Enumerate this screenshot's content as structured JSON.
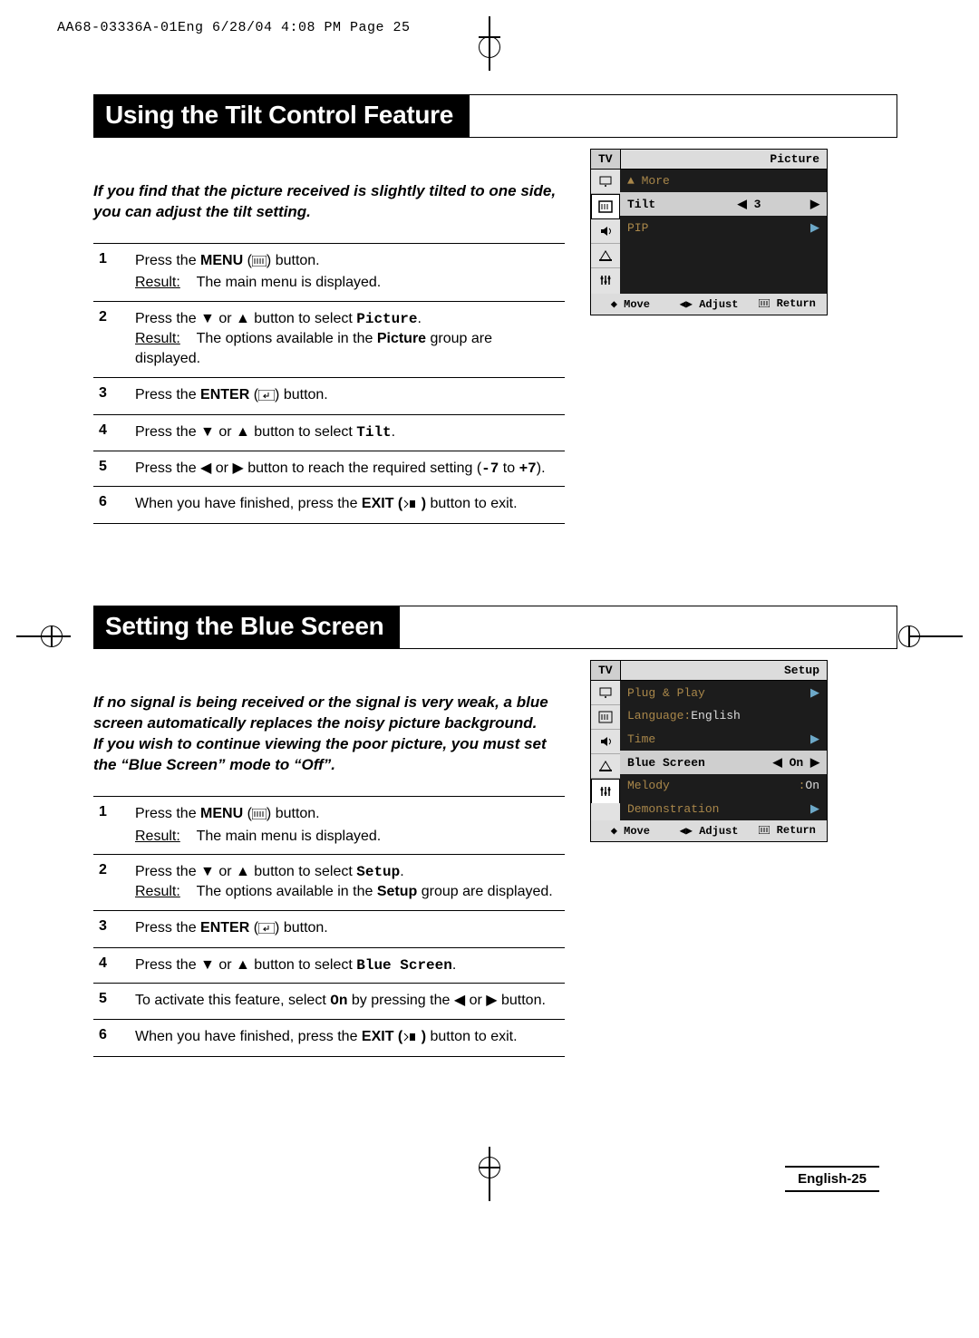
{
  "header_strip": "AA68-03336A-01Eng  6/28/04  4:08 PM  Page 25",
  "section1": {
    "title": "Using the Tilt Control Feature",
    "intro": "If you find that the picture received is slightly tilted to one side, you can adjust the tilt setting.",
    "steps": {
      "s1_a": "Press the ",
      "s1_b": "MENU",
      "s1_c": " button.",
      "s1_result_label": "Result:",
      "s1_result_text": "The main menu is displayed.",
      "s2_a": "Press the ▼ or ▲ button to select ",
      "s2_b": "Picture",
      "s2_c": ".",
      "s2_result_label": "Result:",
      "s2_result_text_a": "The options available in the ",
      "s2_result_text_b": "Picture",
      "s2_result_text_c": " group are displayed.",
      "s3_a": "Press the ",
      "s3_b": "ENTER",
      "s3_c": " button.",
      "s4_a": "Press the ▼ or ▲ button to select ",
      "s4_b": "Tilt",
      "s4_c": ".",
      "s5_a": "Press the ◀ or ▶ button to reach the required setting (",
      "s5_b": "-7",
      "s5_c": " to ",
      "s5_d": "+7",
      "s5_e": ").",
      "s6_a": "When you have finished, press the ",
      "s6_b": "EXIT (",
      "s6_c": " )",
      "s6_d": " button to exit."
    },
    "osd": {
      "title": "Picture",
      "more": "▲ More",
      "rows": [
        {
          "label": "Tilt",
          "lsym": "◀",
          "val": "3",
          "rsym": "▶",
          "sel": true
        },
        {
          "label": "PIP",
          "lsym": "",
          "val": "",
          "rsym": "▶",
          "sel": false
        }
      ],
      "foot_move": "Move",
      "foot_adjust": "Adjust",
      "foot_return": "Return"
    }
  },
  "section2": {
    "title": "Setting the Blue Screen",
    "intro": "If no signal is being received or the signal is very weak, a blue screen automatically replaces the noisy picture background.\nIf you wish to continue viewing the poor picture, you must set the “Blue Screen” mode to “Off”.",
    "steps": {
      "s1_a": "Press the ",
      "s1_b": "MENU",
      "s1_c": " button.",
      "s1_result_label": "Result:",
      "s1_result_text": "The main menu is displayed.",
      "s2_a": "Press the ▼ or ▲ button to select ",
      "s2_b": "Setup",
      "s2_c": ".",
      "s2_result_label": "Result:",
      "s2_result_text_a": "The options available in the ",
      "s2_result_text_b": "Setup",
      "s2_result_text_c": " group are displayed.",
      "s3_a": "Press the ",
      "s3_b": "ENTER",
      "s3_c": " button.",
      "s4_a": "Press the ▼ or ▲ button to select ",
      "s4_b": "Blue Screen",
      "s4_c": ".",
      "s5_a": "To activate this feature, select ",
      "s5_b": "On",
      "s5_c": " by pressing the ◀ or ▶ button.",
      "s6_a": "When you have finished, press the ",
      "s6_b": "EXIT (",
      "s6_c": " )",
      "s6_d": " button to exit."
    },
    "osd": {
      "title": "Setup",
      "rows": [
        {
          "label": "Plug & Play",
          "val": "",
          "rsym": "▶"
        },
        {
          "label": "Language",
          "sep": " : ",
          "val": "English"
        },
        {
          "label": "Time",
          "val": "",
          "rsym": "▶"
        },
        {
          "label": "Blue Screen",
          "lsym": "◀",
          "val": "On",
          "rsym": "▶",
          "sel": true
        },
        {
          "label": "Melody",
          "sep": " : ",
          "val": "On"
        },
        {
          "label": "Demonstration",
          "val": "",
          "rsym": "▶"
        }
      ],
      "foot_move": "Move",
      "foot_adjust": "Adjust",
      "foot_return": "Return"
    }
  },
  "page_foot": "English-25",
  "tv_label": "TV"
}
